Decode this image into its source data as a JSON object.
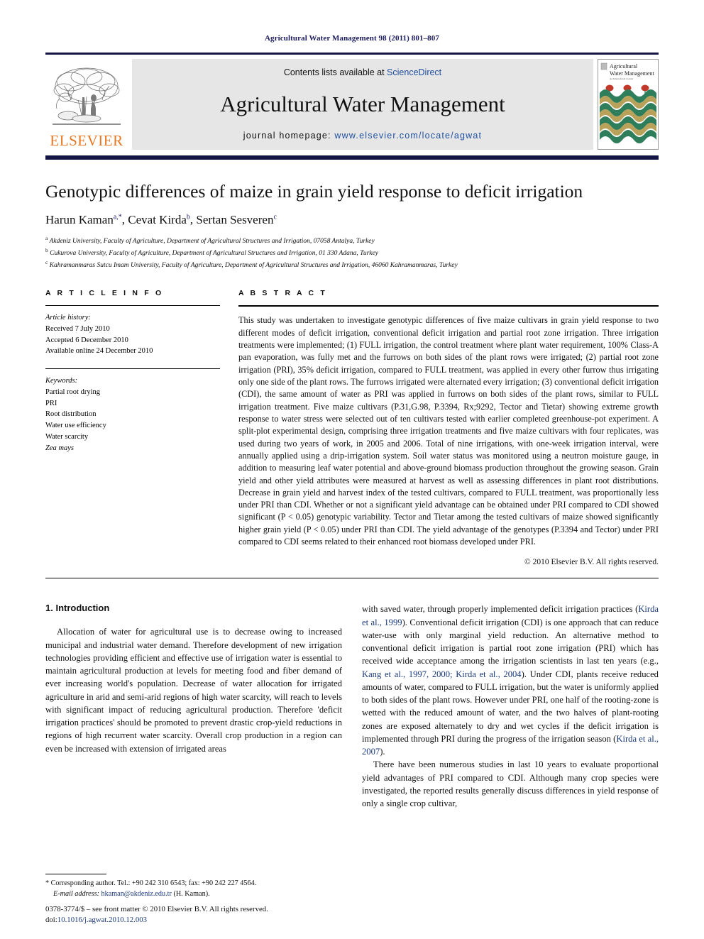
{
  "running_head": "Agricultural Water Management 98 (2011) 801–807",
  "masthead": {
    "contents_prefix": "Contents lists available at ",
    "sciencedirect": "ScienceDirect",
    "journal_title": "Agricultural Water Management",
    "homepage_prefix": "journal homepage:",
    "homepage_url": "www.elsevier.com/locate/agwat",
    "publisher": "ELSEVIER",
    "cover_title_line1": "Agricultural",
    "cover_title_line2": "Water Management",
    "colors": {
      "rule": "#161645",
      "band": "#e6e6e6",
      "link": "#1f4fa0",
      "elsevier_orange": "#E87722",
      "running_head": "#1a1a5e"
    }
  },
  "article": {
    "title": "Genotypic differences of maize in grain yield response to deficit irrigation",
    "authors": "Harun Kaman a,*, Cevat Kirda b, Sertan Sesveren c",
    "author_parts": [
      {
        "name": "Harun Kaman",
        "sup": "a,*"
      },
      {
        "name": "Cevat Kirda",
        "sup": "b"
      },
      {
        "name": "Sertan Sesveren",
        "sup": "c"
      }
    ],
    "affiliations": [
      {
        "marker": "a",
        "text": "Akdeniz University, Faculty of Agriculture, Department of Agricultural Structures and Irrigation, 07058 Antalya, Turkey"
      },
      {
        "marker": "b",
        "text": "Cukurova University, Faculty of Agriculture, Department of Agricultural Structures and Irrigation, 01 330 Adana, Turkey"
      },
      {
        "marker": "c",
        "text": "Kahramanmaras Sutcu Imam University, Faculty of Agriculture, Department of Agricultural Structures and Irrigation, 46060 Kahramanmaras, Turkey"
      }
    ]
  },
  "article_info": {
    "heading": "A R T I C L E    I N F O",
    "history_label": "Article history:",
    "history": [
      "Received 7 July 2010",
      "Accepted 6 December 2010",
      "Available online 24 December 2010"
    ],
    "keywords_label": "Keywords:",
    "keywords": [
      "Partial root drying",
      "PRI",
      "Root distribution",
      "Water use efficiency",
      "Water scarcity",
      "Zea mays"
    ],
    "keywords_italic_last": "Zea mays"
  },
  "abstract": {
    "heading": "A B S T R A C T",
    "text": "This study was undertaken to investigate genotypic differences of five maize cultivars in grain yield response to two different modes of deficit irrigation, conventional deficit irrigation and partial root zone irrigation. Three irrigation treatments were implemented; (1) FULL irrigation, the control treatment where plant water requirement, 100% Class-A pan evaporation, was fully met and the furrows on both sides of the plant rows were irrigated; (2) partial root zone irrigation (PRI), 35% deficit irrigation, compared to FULL treatment, was applied in every other furrow thus irrigating only one side of the plant rows. The furrows irrigated were alternated every irrigation; (3) conventional deficit irrigation (CDI), the same amount of water as PRI was applied in furrows on both sides of the plant rows, similar to FULL irrigation treatment. Five maize cultivars (P.31,G.98, P.3394, Rx;9292, Tector and Tietar) showing extreme growth response to water stress were selected out of ten cultivars tested with earlier completed greenhouse-pot experiment. A split-plot experimental design, comprising three irrigation treatments and five maize cultivars with four replicates, was used during two years of work, in 2005 and 2006. Total of nine irrigations, with one-week irrigation interval, were annually applied using a drip-irrigation system. Soil water status was monitored using a neutron moisture gauge, in addition to measuring leaf water potential and above-ground biomass production throughout the growing season. Grain yield and other yield attributes were measured at harvest as well as assessing differences in plant root distributions. Decrease in grain yield and harvest index of the tested cultivars, compared to FULL treatment, was proportionally less under PRI than CDI. Whether or not a significant yield advantage can be obtained under PRI compared to CDI showed significant (P < 0.05) genotypic variability. Tector and Tietar among the tested cultivars of maize showed significantly higher grain yield (P < 0.05) under PRI than CDI. The yield advantage of the genotypes (P.3394 and Tector) under PRI compared to CDI seems related to their enhanced root biomass developed under PRI.",
    "copyright": "© 2010 Elsevier B.V. All rights reserved."
  },
  "introduction": {
    "heading": "1.  Introduction",
    "left_para_1": "Allocation of water for agricultural use is to decrease owing to increased municipal and industrial water demand. Therefore development of new irrigation technologies providing efficient and effective use of irrigation water is essential to maintain agricultural production at levels for meeting food and fiber demand of ever increasing world's population. Decrease of water allocation for irrigated agriculture in arid and semi-arid regions of high water scarcity, will reach to levels with significant impact of reducing agricultural production. Therefore 'deficit irrigation practices' should be promoted to prevent drastic crop-yield reductions in regions of high recurrent water scarcity. Overall crop production in a region can even be increased with extension of irrigated areas",
    "right_para_1_a": "with saved water, through properly implemented deficit irrigation practices (",
    "right_cite_1": "Kirda et al., 1999",
    "right_para_1_b": "). Conventional deficit irrigation (CDI) is one approach that can reduce water-use with only marginal yield reduction. An alternative method to conventional deficit irrigation is partial root zone irrigation (PRI) which has received wide acceptance among the irrigation scientists in last ten years (e.g., ",
    "right_cite_2": "Kang et al., 1997, 2000; Kirda et al., 2004",
    "right_para_1_c": "). Under CDI, plants receive reduced amounts of water, compared to FULL irrigation, but the water is uniformly applied to both sides of the plant rows. However under PRI, one half of the rooting-zone is wetted with the reduced amount of water, and the two halves of plant-rooting zones are exposed alternately to dry and wet cycles if the deficit irrigation is implemented through PRI during the progress of the irrigation season (",
    "right_cite_3": "Kirda et al., 2007",
    "right_para_1_d": ").",
    "right_para_2": "There have been numerous studies in last 10 years to evaluate proportional yield advantages of PRI compared to CDI. Although many crop species were investigated, the reported results generally discuss differences in yield response of only a single crop cultivar,"
  },
  "footnotes": {
    "corresponding_marker": "*",
    "corresponding": "Corresponding author. Tel.: +90 242 310 6543; fax: +90 242 227 4564.",
    "email_label": "E-mail address:",
    "email": "hkaman@akdeniz.edu.tr",
    "email_owner": "(H. Kaman)."
  },
  "imprint": {
    "line1": "0378-3774/$ – see front matter © 2010 Elsevier B.V. All rights reserved.",
    "doi_label": "doi:",
    "doi": "10.1016/j.agwat.2010.12.003"
  }
}
